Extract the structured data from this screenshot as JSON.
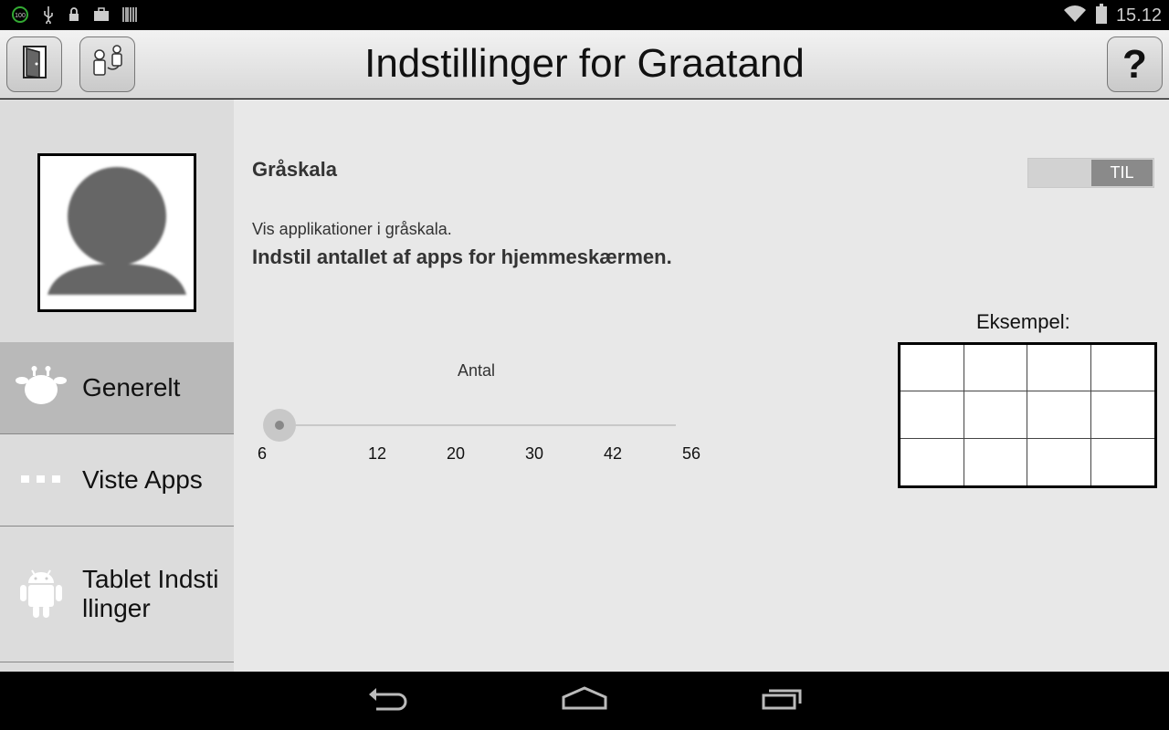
{
  "status_bar": {
    "time": "15.12",
    "left_icons": [
      "battery-100-icon",
      "usb-icon",
      "lock-icon",
      "briefcase-icon",
      "barcode-icon"
    ],
    "right_icons": [
      "wifi-icon",
      "battery-icon"
    ]
  },
  "header": {
    "title": "Indstillinger for Graatand",
    "help_label": "?"
  },
  "sidebar": {
    "items": [
      {
        "label": "Generelt",
        "icon": "giraffe-icon",
        "selected": true
      },
      {
        "label": "Viste Apps",
        "icon": "dots-icon",
        "selected": false
      },
      {
        "label": "Tablet Indstillinger",
        "icon": "android-icon",
        "selected": false
      }
    ]
  },
  "settings": {
    "grayscale": {
      "title": "Gråskala",
      "toggle_label": "TIL",
      "description": "Vis applikationer i gråskala."
    },
    "app_count": {
      "title": "Indstil antallet af apps for hjemmeskærmen.",
      "slider_label": "Antal",
      "ticks": [
        "6",
        "12",
        "20",
        "30",
        "42",
        "56"
      ],
      "selected_value": "6"
    },
    "example": {
      "label": "Eksempel:",
      "rows": 3,
      "columns": 4
    }
  },
  "colors": {
    "sidebar_bg": "#dcdcdc",
    "sidebar_selected": "#b9b9b9",
    "content_bg": "#e8e8e8",
    "toggle_on": "#8a8a8a"
  }
}
